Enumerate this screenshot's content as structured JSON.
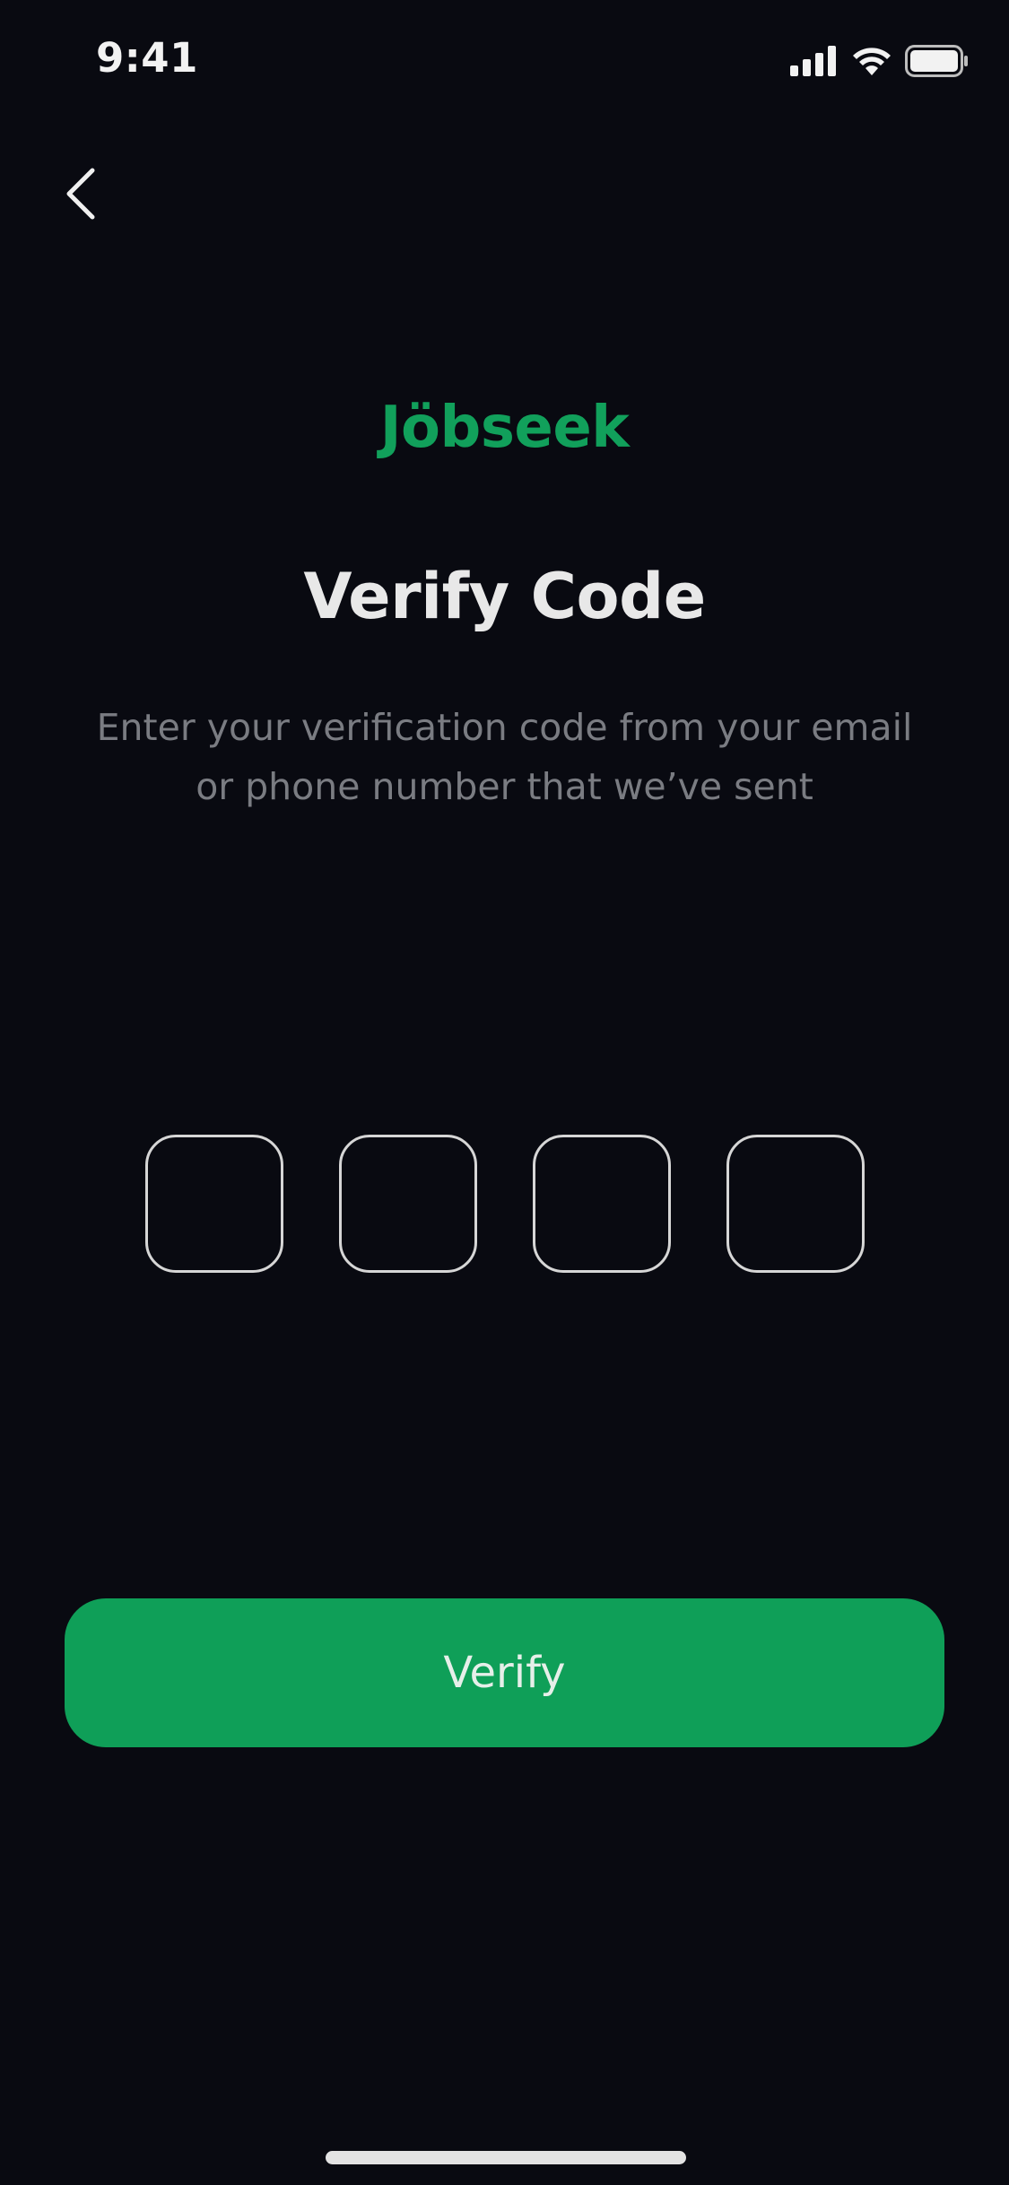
{
  "status_bar": {
    "time": "9:41",
    "icons": [
      "cellular-signal-icon",
      "wifi-icon",
      "battery-icon"
    ]
  },
  "nav": {
    "back_icon": "chevron-left-icon"
  },
  "brand": {
    "name": "Jöbseek",
    "color": "#11a05b"
  },
  "header": {
    "title": "Verify Code",
    "subtitle_line1": "Enter your verification code from your email",
    "subtitle_line2": "or phone number that we’ve sent"
  },
  "code_inputs": {
    "values": [
      "",
      "",
      "",
      ""
    ]
  },
  "actions": {
    "verify_label": "Verify",
    "verify_color": "#0f9f58"
  },
  "theme": {
    "background": "#090a11",
    "text": "#e8e8e8",
    "muted_text": "#7a7c82"
  }
}
